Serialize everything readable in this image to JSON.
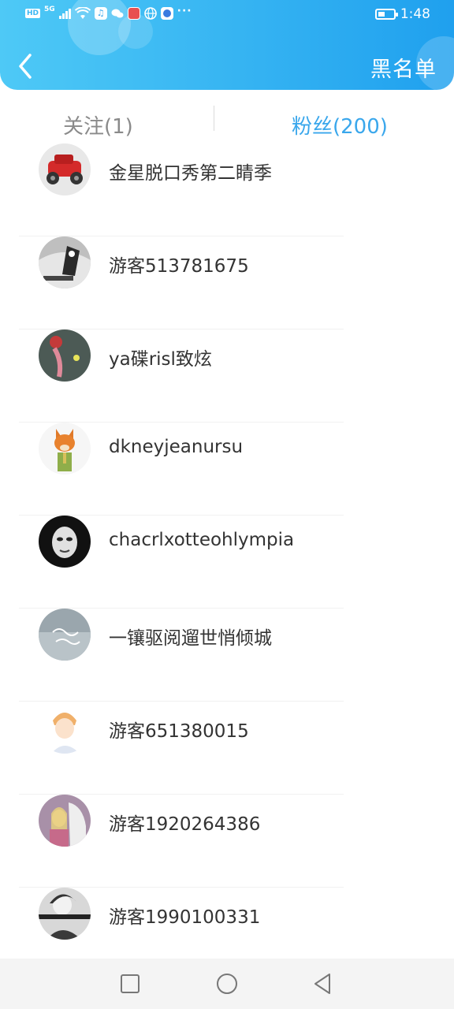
{
  "status_bar": {
    "network_badge": "HD",
    "network_type": "5G",
    "time": "1:48",
    "more": "···"
  },
  "header": {
    "back_icon": "chevron-left-icon",
    "blacklist_label": "黑名单",
    "colors": {
      "gradient_start": "#4ec9f6",
      "gradient_end": "#1fa0ee"
    }
  },
  "tabs": [
    {
      "label": "关注(1)",
      "active": false
    },
    {
      "label": "粉丝(200)",
      "active": true
    }
  ],
  "accent_color": "#3aa7ec",
  "fans": [
    {
      "name": "金星脱口秀第二睛季",
      "avatar": "red-toy-car"
    },
    {
      "name": "游客513781675",
      "avatar": "bw-figure"
    },
    {
      "name": "ya碟risl致炫",
      "avatar": "flower-bud"
    },
    {
      "name": "dkneyjeanursu",
      "avatar": "cartoon-fox"
    },
    {
      "name": "chacrlxotteohlympia",
      "avatar": "bw-mask"
    },
    {
      "name": "一镶驱阅遛世悄倾城",
      "avatar": "hello-august"
    },
    {
      "name": "游客651380015",
      "avatar": "anime-boy"
    },
    {
      "name": "游客1920264386",
      "avatar": "girl-with-horse"
    },
    {
      "name": "游客1990100331",
      "avatar": "bw-girl"
    }
  ],
  "nav_bar": [
    "square-recents-icon",
    "circle-home-icon",
    "triangle-back-icon"
  ]
}
